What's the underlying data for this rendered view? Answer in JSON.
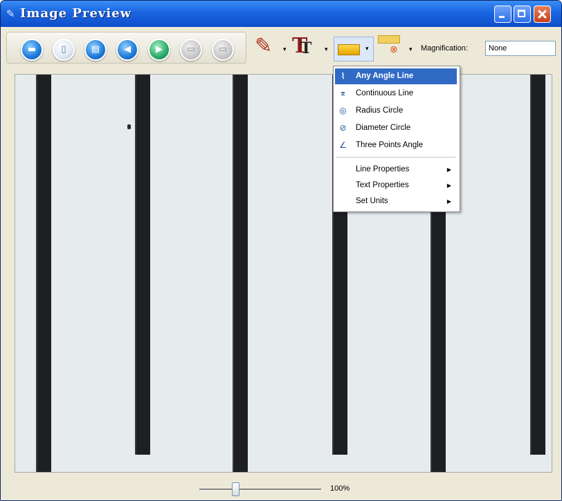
{
  "window": {
    "title": "Image Preview",
    "title_icon": "pen-nib-icon",
    "controls": [
      "minimize",
      "maximize",
      "close"
    ]
  },
  "toolbar": {
    "buttons": [
      {
        "name": "save",
        "icon": "save-icon",
        "enabled": true
      },
      {
        "name": "new",
        "icon": "document-icon",
        "enabled": true
      },
      {
        "name": "print",
        "icon": "print-icon",
        "enabled": true
      },
      {
        "name": "previous",
        "icon": "arrow-left-icon",
        "enabled": true
      },
      {
        "name": "next",
        "icon": "arrow-right-icon",
        "enabled": true
      },
      {
        "name": "zoom-in",
        "icon": "zoom-in-icon",
        "enabled": false
      },
      {
        "name": "zoom-out",
        "icon": "zoom-out-icon",
        "enabled": false
      }
    ],
    "tools": [
      {
        "name": "pen",
        "icon": "pencil-icon"
      },
      {
        "name": "text",
        "icon": "text-tool-icon"
      },
      {
        "name": "measure",
        "icon": "measure-tool-icon"
      },
      {
        "name": "calibrate",
        "icon": "calibration-icon"
      }
    ],
    "magnification_label": "Magnification:",
    "magnification_value": "None"
  },
  "menu": {
    "items": [
      {
        "label": "Any Angle Line",
        "icon": "angle-line-icon",
        "highlighted": true
      },
      {
        "label": "Continuous Line",
        "icon": "continuous-line-icon",
        "highlighted": false
      },
      {
        "label": "Radius Circle",
        "icon": "radius-circle-icon",
        "highlighted": false
      },
      {
        "label": "Diameter Circle",
        "icon": "diameter-circle-icon",
        "highlighted": false
      },
      {
        "label": "Three Points Angle",
        "icon": "angle-icon",
        "highlighted": false
      }
    ],
    "submenus": [
      {
        "label": "Line Properties"
      },
      {
        "label": "Text Properties"
      },
      {
        "label": "Set Units"
      }
    ]
  },
  "statusbar": {
    "zoom_percent": "100%",
    "slider_level": 0.3
  },
  "colors": {
    "title_bar": "#1a64e0",
    "menu_highlight": "#316ac5",
    "window_bg": "#ece9d8"
  }
}
